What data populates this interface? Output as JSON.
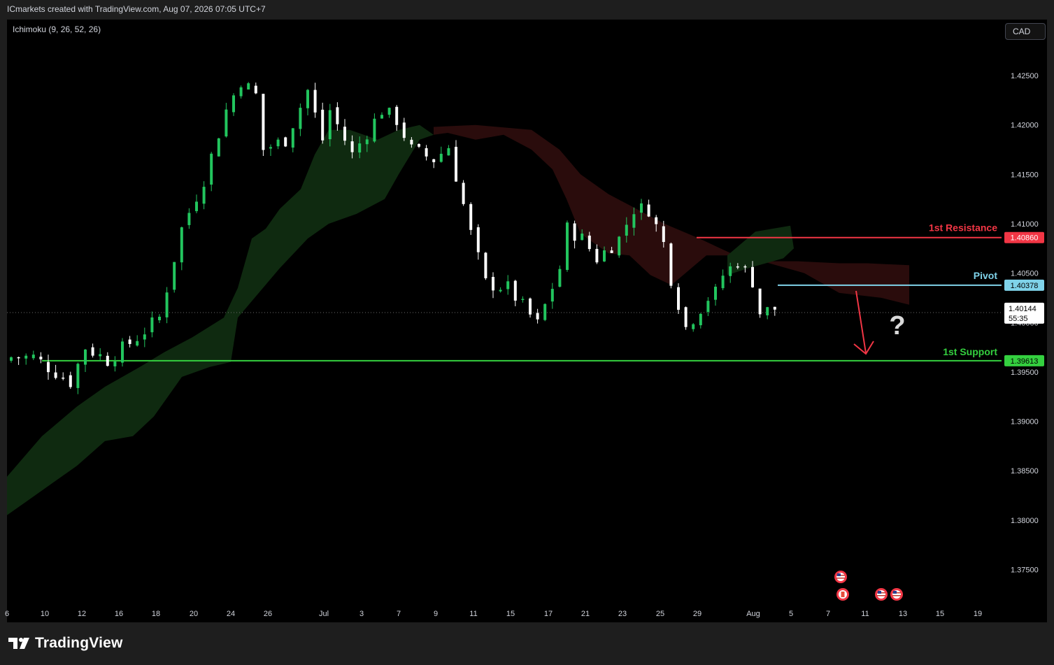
{
  "header": {
    "title": "ICmarkets created with TradingView.com, Aug 07, 2026 07:05 UTC+7"
  },
  "indicator": {
    "label": "Ichimoku (9, 26, 52, 26)"
  },
  "currency": {
    "label": "CAD"
  },
  "brand": {
    "name": "TradingView"
  },
  "colors": {
    "background": "#000000",
    "up_candle": "#22c55e",
    "down_candle": "#ffffff",
    "resistance": "#f23645",
    "pivot": "#7fd3ea",
    "support": "#34d03f",
    "kumo_bull": "#0f2a10",
    "kumo_bear": "#2a0c0c"
  },
  "chart_data": {
    "type": "candlestick",
    "symbol_quote": "CAD",
    "yaxis": {
      "ylim": [
        1.3718,
        1.4303
      ],
      "ticks": [
        1.425,
        1.42,
        1.415,
        1.41,
        1.405,
        1.4,
        1.395,
        1.39,
        1.385,
        1.38,
        1.375
      ]
    },
    "xaxis": {
      "labels": [
        "6",
        "10",
        "12",
        "16",
        "18",
        "20",
        "24",
        "26",
        "Jul",
        "3",
        "7",
        "9",
        "11",
        "15",
        "17",
        "21",
        "23",
        "25",
        "29",
        "Aug",
        "5",
        "7",
        "11",
        "13",
        "15",
        "19"
      ]
    },
    "levels": [
      {
        "name": "1st Resistance",
        "value": 1.4086,
        "label": "1.40860"
      },
      {
        "name": "Pivot",
        "value": 1.40378,
        "label": "1.40378"
      },
      {
        "name": "1st Support",
        "value": 1.39613,
        "label": "1.39613"
      }
    ],
    "current_price": {
      "value": 1.40144,
      "label": "1.40144",
      "countdown": "55:35"
    },
    "annotations": [
      {
        "type": "arrow",
        "direction": "down",
        "color": "red"
      },
      {
        "type": "text",
        "text": "?"
      }
    ],
    "ichimoku": {
      "params": [
        9,
        26,
        52,
        26
      ]
    },
    "candles_keyframes": [
      [
        0,
        1.3965
      ],
      [
        3,
        1.3965
      ],
      [
        8,
        1.394
      ],
      [
        10,
        1.3975
      ],
      [
        13,
        1.3962
      ],
      [
        17,
        1.3985
      ],
      [
        20,
        1.4005
      ],
      [
        23,
        1.4095
      ],
      [
        26,
        1.4145
      ],
      [
        29,
        1.4215
      ],
      [
        31,
        1.4245
      ],
      [
        33,
        1.423
      ],
      [
        34,
        1.4175
      ],
      [
        37,
        1.4185
      ],
      [
        40,
        1.4235
      ],
      [
        42,
        1.4185
      ],
      [
        43,
        1.4215
      ],
      [
        46,
        1.417
      ],
      [
        50,
        1.4215
      ],
      [
        52,
        1.4205
      ],
      [
        54,
        1.4175
      ],
      [
        57,
        1.4165
      ],
      [
        59,
        1.4178
      ],
      [
        62,
        1.409
      ],
      [
        64,
        1.404
      ],
      [
        67,
        1.4035
      ],
      [
        71,
        1.3998
      ],
      [
        74,
        1.4055
      ],
      [
        75,
        1.4095
      ],
      [
        77,
        1.4085
      ],
      [
        79,
        1.4065
      ],
      [
        82,
        1.4085
      ],
      [
        84,
        1.4115
      ],
      [
        86,
        1.4115
      ],
      [
        88,
        1.408
      ],
      [
        89,
        1.4045
      ],
      [
        91,
        1.3995
      ],
      [
        94,
        1.4025
      ],
      [
        95,
        1.403
      ],
      [
        96,
        1.4048
      ],
      [
        98,
        1.4062
      ],
      [
        100,
        1.4042
      ],
      [
        101,
        1.401
      ],
      [
        103,
        1.4014
      ]
    ]
  }
}
